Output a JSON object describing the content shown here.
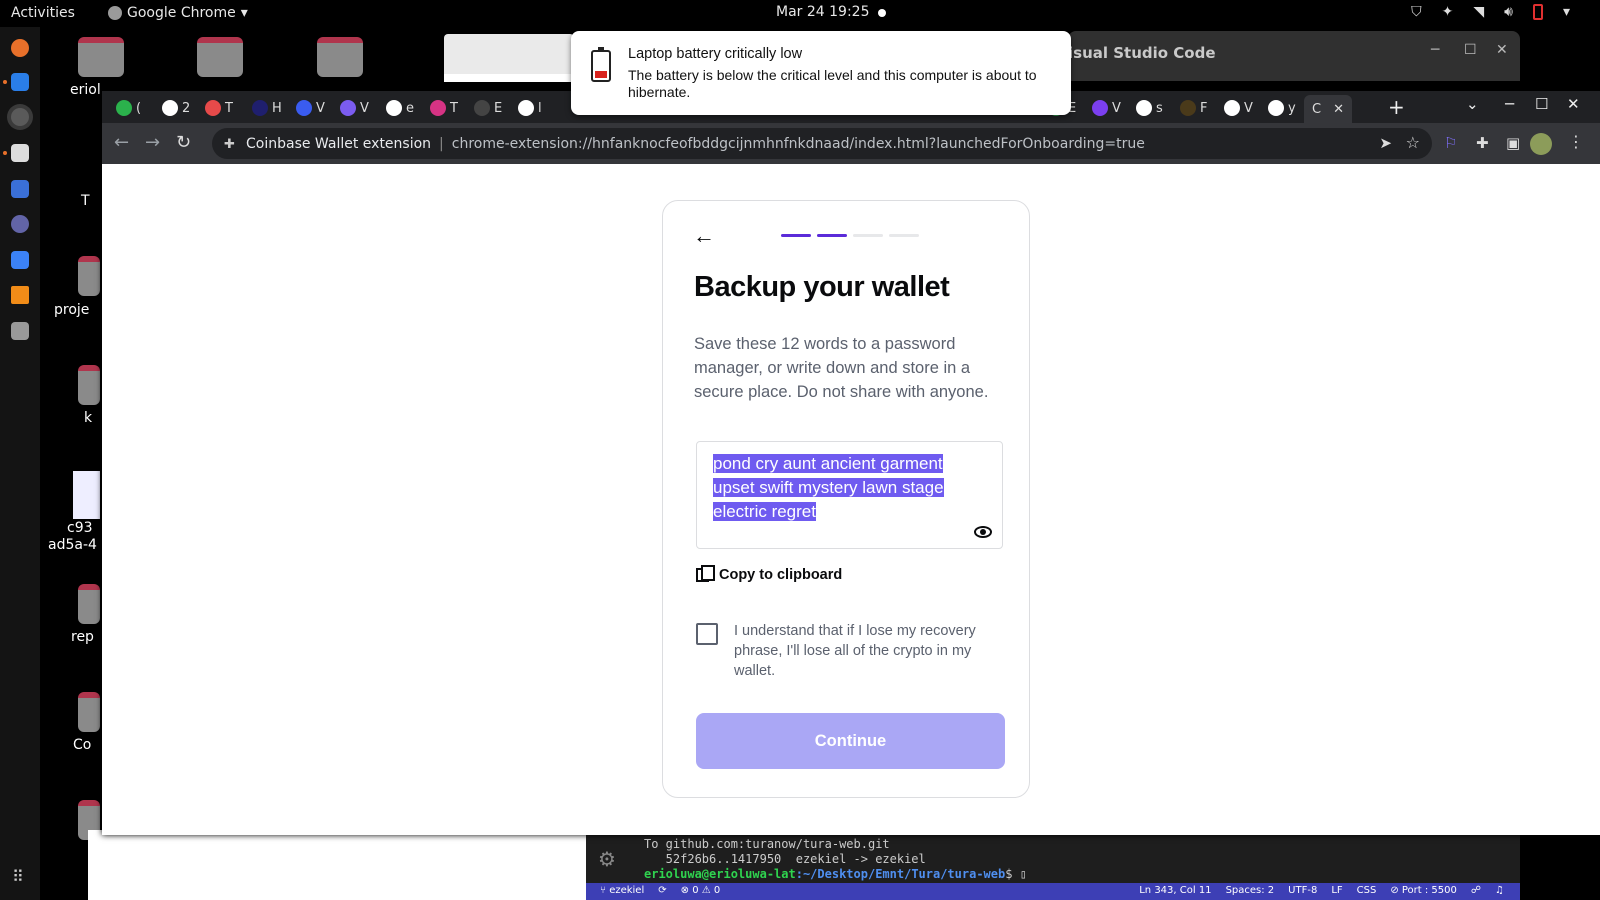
{
  "topbar": {
    "activities": "Activities",
    "app_name": "Google Chrome",
    "clock": "Mar 24  19:25"
  },
  "desktop": {
    "labels": [
      "eriol",
      "T",
      "proje",
      "k",
      "c93",
      "ad5a-4",
      "rep",
      "Co"
    ]
  },
  "notification": {
    "title": "Laptop battery critically low",
    "body": "The battery is below the critical level and this computer is about to hibernate."
  },
  "background_window": {
    "title": "isual Studio Code",
    "terminal": {
      "line1": "To github.com:turanow/tura-web.git",
      "line2": "   52f26b6..1417950  ezekiel -> ezekiel",
      "prompt_user": "erioluwa@erioluwa-lat",
      "prompt_path": ":~/Desktop/Emnt/Tura/tura-web",
      "prompt_end": "$ "
    },
    "status": {
      "branch": "ezekiel",
      "problems": "⊗ 0 ⚠ 0",
      "position": "Ln 343, Col 11",
      "spaces": "Spaces: 2",
      "encoding": "UTF-8",
      "eol": "LF",
      "language": "CSS",
      "port": "⊘ Port : 5500"
    }
  },
  "chrome": {
    "tabs": [
      {
        "label": "(",
        "color": "#2bb24c"
      },
      {
        "label": "2",
        "color": "#ffffff"
      },
      {
        "label": "T",
        "color": "#e64a4a"
      },
      {
        "label": "H",
        "color": "#1f1f6e"
      },
      {
        "label": "V",
        "color": "#3a5cf0"
      },
      {
        "label": "V",
        "color": "#7b5cf0"
      },
      {
        "label": "e",
        "color": "#ffffff"
      },
      {
        "label": "T",
        "color": "#d63384"
      },
      {
        "label": "E",
        "color": "#444444"
      },
      {
        "label": "l",
        "color": "#ffffff"
      }
    ],
    "tabs_right": [
      {
        "label": "E",
        "color": "#3aa757"
      },
      {
        "label": "V",
        "color": "#7b3ff0"
      },
      {
        "label": "s",
        "color": "#ffffff"
      },
      {
        "label": "F",
        "color": "#4a3a1a"
      },
      {
        "label": "V",
        "color": "#ffffff"
      },
      {
        "label": "y",
        "color": "#ffffff"
      }
    ],
    "active_tab": "C",
    "omnibox": {
      "site": "Coinbase Wallet extension",
      "url": "chrome-extension://hnfanknocfeofbddgcijnmhnfnkdnaad/index.html?launchedForOnboarding=true"
    }
  },
  "wallet": {
    "progress": {
      "steps": 4,
      "completed": 2,
      "active_color": "#5b2bd9"
    },
    "title": "Backup your wallet",
    "description": "Save these 12 words to a password manager, or write down and store in a secure place. Do not share with anyone.",
    "phrase_lines": [
      "pond cry aunt ancient garment",
      "upset swift mystery lawn stage",
      "electric regret"
    ],
    "copy_label": "Copy to clipboard",
    "acknowledge": "I understand that if I lose my recovery phrase, I'll lose all of the crypto in my wallet.",
    "acknowledge_checked": false,
    "continue_label": "Continue",
    "continue_enabled": false,
    "colors": {
      "highlight": "#6f5bf0",
      "button_disabled": "#aaa7f5"
    }
  }
}
